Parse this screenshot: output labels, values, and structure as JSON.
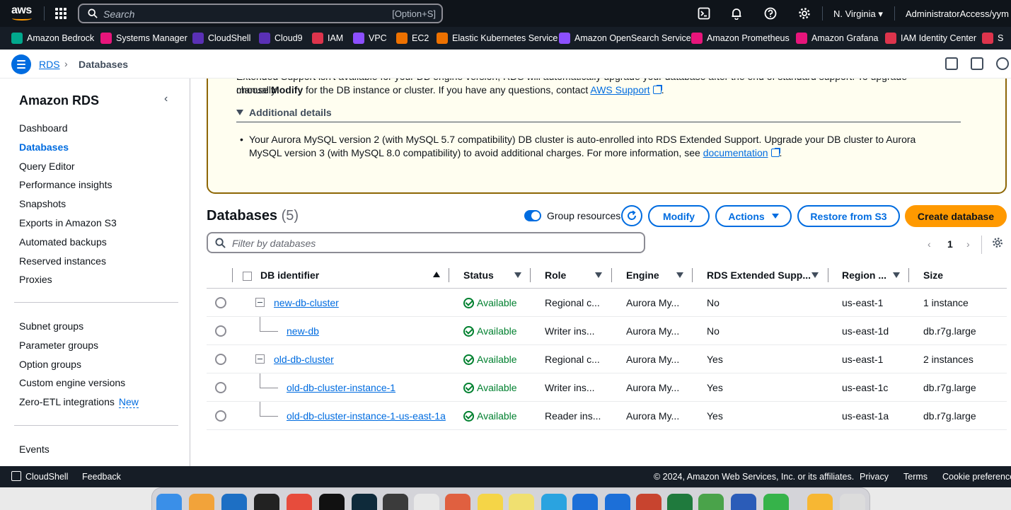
{
  "topnav": {
    "search_placeholder": "Search",
    "search_shortcut": "[Option+S]",
    "region": "N. Virginia ▾",
    "account": "AdministratorAccess/yym ▾"
  },
  "favorites": [
    {
      "label": "Amazon Bedrock",
      "color": "#01a88d"
    },
    {
      "label": "Systems Manager",
      "color": "#e7157b"
    },
    {
      "label": "CloudShell",
      "color": "#5a30b5"
    },
    {
      "label": "Cloud9",
      "color": "#5a30b5"
    },
    {
      "label": "IAM",
      "color": "#dd344c"
    },
    {
      "label": "VPC",
      "color": "#8c4fff"
    },
    {
      "label": "EC2",
      "color": "#ed7100"
    },
    {
      "label": "Elastic Kubernetes Service",
      "color": "#ed7100"
    },
    {
      "label": "Amazon OpenSearch Service",
      "color": "#8c4fff"
    },
    {
      "label": "Amazon Prometheus",
      "color": "#e7157b"
    },
    {
      "label": "Amazon Grafana",
      "color": "#e7157b"
    },
    {
      "label": "IAM Identity Center",
      "color": "#dd344c"
    },
    {
      "label": "S",
      "color": "#dd344c"
    }
  ],
  "breadcrumb": {
    "root": "RDS",
    "current": "Databases"
  },
  "sidebar": {
    "title": "Amazon RDS",
    "items": [
      "Dashboard",
      "Databases",
      "Query Editor",
      "Performance insights",
      "Snapshots",
      "Exports in Amazon S3",
      "Automated backups",
      "Reserved instances",
      "Proxies"
    ],
    "items2": [
      "Subnet groups",
      "Parameter groups",
      "Option groups",
      "Custom engine versions",
      "Zero-ETL integrations"
    ],
    "new_badge": "New",
    "items3": [
      "Events"
    ]
  },
  "alert": {
    "line1": "Extended Support isn't available for your DB engine version, RDS will automatically upgrade your database after the end of standard support. To upgrade manually",
    "line2_a": "choose ",
    "line2_bold": "Modify",
    "line2_b": " for the DB instance or cluster. If you have any questions, contact ",
    "line2_link": "AWS Support",
    "line2_end": ".",
    "additional": "Additional details",
    "bullet_a": "Your Aurora MySQL version 2 (with MySQL 5.7 compatibility) DB cluster is auto-enrolled into RDS Extended Support. Upgrade your DB cluster to Aurora MySQL version 3 (with MySQL 8.0 compatibility) to avoid additional charges. For more information, see ",
    "bullet_link": "documentation",
    "bullet_end": "."
  },
  "databases": {
    "title": "Databases",
    "count": "(5)",
    "group_label": "Group resources",
    "modify": "Modify",
    "actions": "Actions",
    "restore": "Restore from S3",
    "create": "Create database",
    "filter_placeholder": "Filter by databases",
    "page": "1",
    "columns": [
      "DB identifier",
      "Status",
      "Role",
      "Engine",
      "RDS Extended Supp...",
      "Region ...",
      "Size"
    ],
    "rows": [
      {
        "id": "new-db-cluster",
        "status": "Available",
        "role": "Regional c...",
        "engine": "Aurora My...",
        "ext": "No",
        "region": "us-east-1",
        "size": "1 instance"
      },
      {
        "id": "new-db",
        "status": "Available",
        "role": "Writer ins...",
        "engine": "Aurora My...",
        "ext": "No",
        "region": "us-east-1d",
        "size": "db.r7g.large"
      },
      {
        "id": "old-db-cluster",
        "status": "Available",
        "role": "Regional c...",
        "engine": "Aurora My...",
        "ext": "Yes",
        "region": "us-east-1",
        "size": "2 instances"
      },
      {
        "id": "old-db-cluster-instance-1",
        "status": "Available",
        "role": "Writer ins...",
        "engine": "Aurora My...",
        "ext": "Yes",
        "region": "us-east-1c",
        "size": "db.r7g.large"
      },
      {
        "id": "old-db-cluster-instance-1-us-east-1a",
        "status": "Available",
        "role": "Reader ins...",
        "engine": "Aurora My...",
        "ext": "Yes",
        "region": "us-east-1a",
        "size": "db.r7g.large"
      }
    ]
  },
  "footer": {
    "cloudshell": "CloudShell",
    "feedback": "Feedback",
    "copyright": "© 2024, Amazon Web Services, Inc. or its affiliates.",
    "privacy": "Privacy",
    "terms": "Terms",
    "cookies": "Cookie preferences"
  }
}
